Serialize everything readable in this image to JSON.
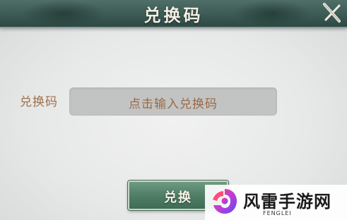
{
  "dialog": {
    "title": "兑换码"
  },
  "form": {
    "label": "兑换码",
    "input_placeholder": "点击输入兑换码"
  },
  "actions": {
    "redeem_label": "兑换"
  },
  "watermark": {
    "name": "风雷手游网",
    "sub": "FENGLEI"
  },
  "colors": {
    "header_bg": "#3d5a54",
    "label_text": "#a0704a",
    "input_bg": "#c2c4c3",
    "button_bg": "#4f7f66"
  }
}
